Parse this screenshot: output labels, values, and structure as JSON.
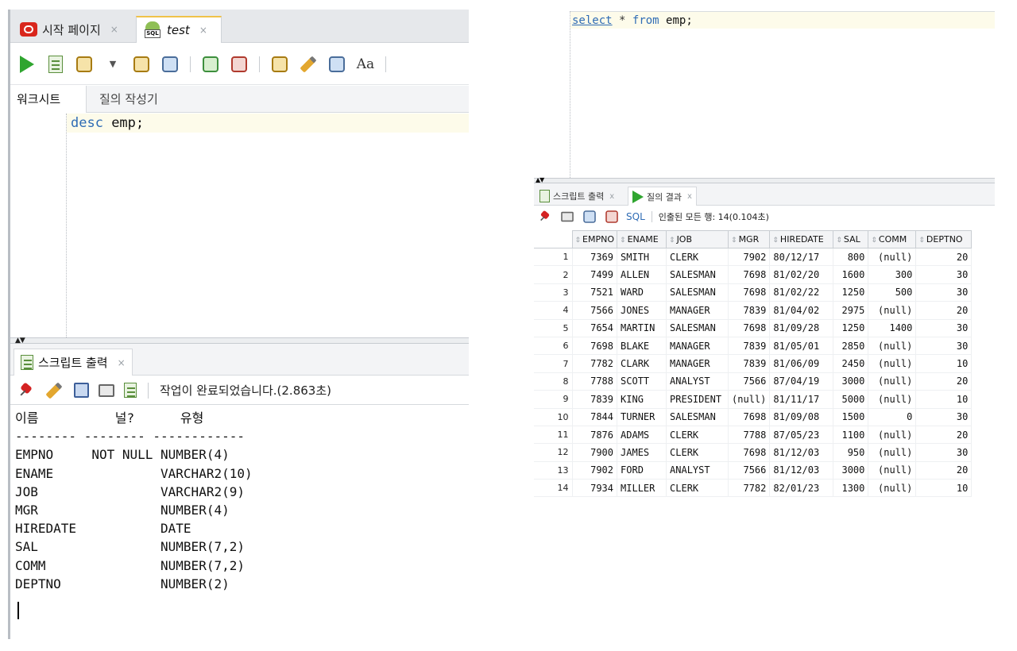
{
  "left": {
    "tabs": [
      {
        "label": "시작 페이지",
        "close": "×"
      },
      {
        "label": "test",
        "close": "×"
      }
    ],
    "subtabs": [
      "워크시트",
      "질의 작성기"
    ],
    "editor": {
      "keyword": "desc",
      "rest": " emp;"
    },
    "output_tab": {
      "label": "스크립트 출력",
      "close": "×"
    },
    "status": "작업이 완료되었습니다.(2.863초)",
    "describe": {
      "headers": [
        "이름",
        "널?",
        "유형"
      ],
      "separator": "-------- -------- ------------",
      "rows": [
        {
          "name": "EMPNO",
          "null": "NOT NULL",
          "type": "NUMBER(4)"
        },
        {
          "name": "ENAME",
          "null": "",
          "type": "VARCHAR2(10)"
        },
        {
          "name": "JOB",
          "null": "",
          "type": "VARCHAR2(9)"
        },
        {
          "name": "MGR",
          "null": "",
          "type": "NUMBER(4)"
        },
        {
          "name": "HIREDATE",
          "null": "",
          "type": "DATE"
        },
        {
          "name": "SAL",
          "null": "",
          "type": "NUMBER(7,2)"
        },
        {
          "name": "COMM",
          "null": "",
          "type": "NUMBER(7,2)"
        },
        {
          "name": "DEPTNO",
          "null": "",
          "type": "NUMBER(2)"
        }
      ]
    }
  },
  "right": {
    "editor": {
      "kw1": "select",
      "star": "*",
      "kw2": "from",
      "rest": " emp;"
    },
    "tabs": [
      {
        "label": "스크립트 출력",
        "close": "x"
      },
      {
        "label": "질의 결과",
        "close": "x"
      }
    ],
    "sql_label": "SQL",
    "status": "인출된 모든 행: 14(0.104초)",
    "columns": [
      "EMPNO",
      "ENAME",
      "JOB",
      "MGR",
      "HIREDATE",
      "SAL",
      "COMM",
      "DEPTNO"
    ],
    "rows": [
      [
        "1",
        "7369",
        "SMITH",
        "CLERK",
        "7902",
        "80/12/17",
        "800",
        "(null)",
        "20"
      ],
      [
        "2",
        "7499",
        "ALLEN",
        "SALESMAN",
        "7698",
        "81/02/20",
        "1600",
        "300",
        "30"
      ],
      [
        "3",
        "7521",
        "WARD",
        "SALESMAN",
        "7698",
        "81/02/22",
        "1250",
        "500",
        "30"
      ],
      [
        "4",
        "7566",
        "JONES",
        "MANAGER",
        "7839",
        "81/04/02",
        "2975",
        "(null)",
        "20"
      ],
      [
        "5",
        "7654",
        "MARTIN",
        "SALESMAN",
        "7698",
        "81/09/28",
        "1250",
        "1400",
        "30"
      ],
      [
        "6",
        "7698",
        "BLAKE",
        "MANAGER",
        "7839",
        "81/05/01",
        "2850",
        "(null)",
        "30"
      ],
      [
        "7",
        "7782",
        "CLARK",
        "MANAGER",
        "7839",
        "81/06/09",
        "2450",
        "(null)",
        "10"
      ],
      [
        "8",
        "7788",
        "SCOTT",
        "ANALYST",
        "7566",
        "87/04/19",
        "3000",
        "(null)",
        "20"
      ],
      [
        "9",
        "7839",
        "KING",
        "PRESIDENT",
        "(null)",
        "81/11/17",
        "5000",
        "(null)",
        "10"
      ],
      [
        "10",
        "7844",
        "TURNER",
        "SALESMAN",
        "7698",
        "81/09/08",
        "1500",
        "0",
        "30"
      ],
      [
        "11",
        "7876",
        "ADAMS",
        "CLERK",
        "7788",
        "87/05/23",
        "1100",
        "(null)",
        "20"
      ],
      [
        "12",
        "7900",
        "JAMES",
        "CLERK",
        "7698",
        "81/12/03",
        "950",
        "(null)",
        "30"
      ],
      [
        "13",
        "7902",
        "FORD",
        "ANALYST",
        "7566",
        "81/12/03",
        "3000",
        "(null)",
        "20"
      ],
      [
        "14",
        "7934",
        "MILLER",
        "CLERK",
        "7782",
        "82/01/23",
        "1300",
        "(null)",
        "10"
      ]
    ]
  }
}
